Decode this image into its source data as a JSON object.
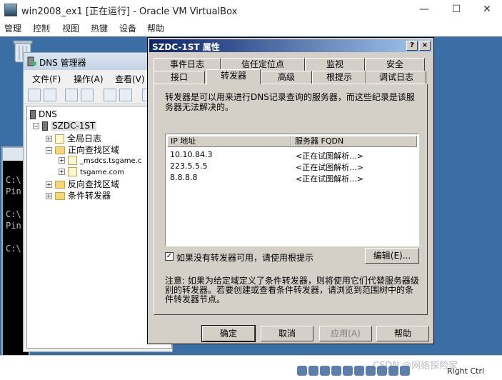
{
  "vbox": {
    "title": "win2008_ex1 [正在运行] - Oracle VM VirtualBox",
    "menu": [
      "管理",
      "控制",
      "视图",
      "热键",
      "设备",
      "帮助"
    ],
    "host_key": "Right Ctrl",
    "watermark": "CSDN @网络探险家"
  },
  "console": {
    "lines": [
      "C:\\",
      "Pin",
      "C:\\",
      "Pin",
      "C:\\"
    ]
  },
  "dns_manager": {
    "title": "DNS 管理器",
    "menu": [
      "文件(F)",
      "操作(A)",
      "查看(V)"
    ],
    "tree": {
      "root": "DNS",
      "server": "SZDC-1ST",
      "global_logs": "全局日志",
      "forward_zones": "正向查找区域",
      "zone_msdcs": "_msdcs.tsgame.c",
      "zone_tsgame": "tsgame.com",
      "reverse_zones": "反向查找区域",
      "conditional_forwarders": "条件转发器"
    }
  },
  "dialog": {
    "title": "SZDC-1ST 属性",
    "help_btn": "?",
    "close_btn": "×",
    "tabs_row1": [
      "事件日志",
      "信任定位点",
      "监视",
      "安全"
    ],
    "tabs_row2": [
      "接口",
      "转发器",
      "高级",
      "根提示",
      "调试日志"
    ],
    "active_tab": "转发器",
    "description": "转发器是可以用来进行DNS记录查询的服务器，而这些纪录是该服务器无法解决的。",
    "columns": [
      "IP 地址",
      "服务器 FQDN"
    ],
    "forwarders": [
      {
        "ip": "10.10.84.3",
        "fqdn": "<正在试图解析...>"
      },
      {
        "ip": "223.5.5.5",
        "fqdn": "<正在试图解析...>"
      },
      {
        "ip": "8.8.8.8",
        "fqdn": "<正在试图解析...>"
      }
    ],
    "use_root_hints": "如果没有转发器可用，请使用根提示",
    "checkbox_mark": "✓",
    "edit_btn": "编辑(E)...",
    "note": "注意: 如果为给定域定义了条件转发器，则将使用它们代替服务器级别的转发器。若要创建或查看条件转发器，请浏览到范围树中的条件转发器节点。",
    "buttons": {
      "ok": "确定",
      "cancel": "取消",
      "apply": "应用(A)",
      "help": "帮助"
    }
  },
  "colors": {
    "desktop": "#3a6ea5",
    "dialog_face": "#d4d0c8",
    "dialog_title_start": "#0a246a",
    "dialog_title_end": "#a6caf0"
  }
}
